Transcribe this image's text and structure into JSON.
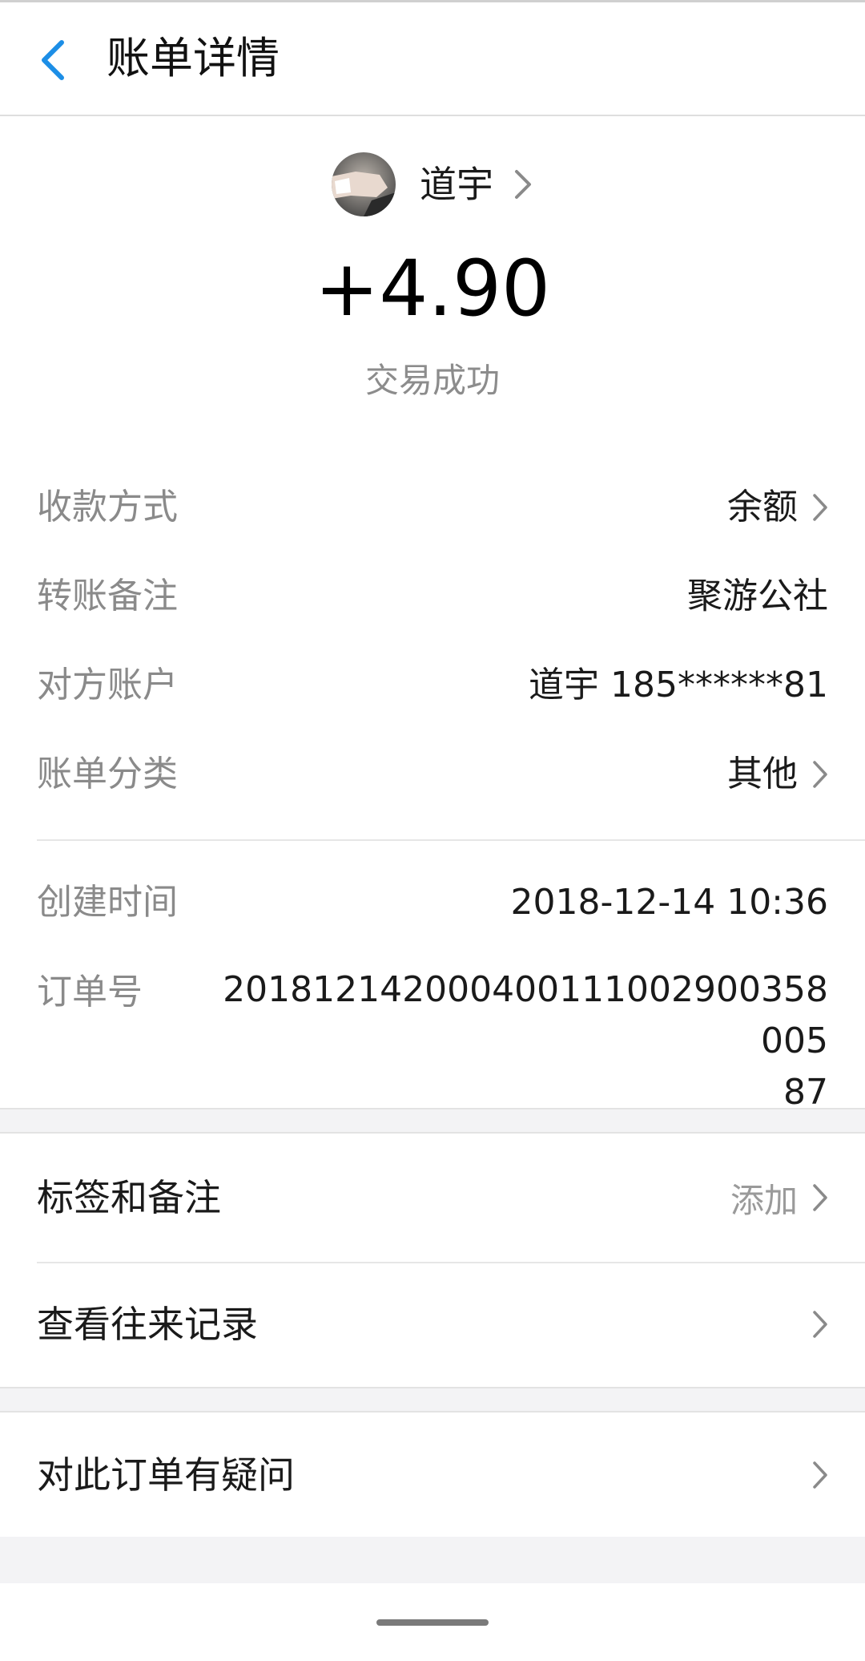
{
  "header": {
    "title": "账单详情",
    "back_icon": "chevron-left-icon",
    "accent": "#1c8ee6"
  },
  "payer": {
    "name": "道宇",
    "avatar_icon": "avatar"
  },
  "transaction": {
    "amount": "+4.90",
    "status": "交易成功"
  },
  "details": [
    {
      "label": "收款方式",
      "value": "余额",
      "has_chevron": true
    },
    {
      "label": "转账备注",
      "value": "聚游公社",
      "has_chevron": false
    },
    {
      "label": "对方账户",
      "value": "道宇 185******81",
      "has_chevron": false
    },
    {
      "label": "账单分类",
      "value": "其他",
      "has_chevron": true
    }
  ],
  "meta": [
    {
      "label": "创建时间",
      "value": "2018-12-14 10:36"
    },
    {
      "label": "订单号",
      "value": "2018121420004001110029003580 05 87"
    }
  ],
  "actions": {
    "tags": {
      "label": "标签和备注",
      "hint": "添加"
    },
    "history": {
      "label": "查看往来记录"
    },
    "dispute": {
      "label": "对此订单有疑问"
    }
  }
}
